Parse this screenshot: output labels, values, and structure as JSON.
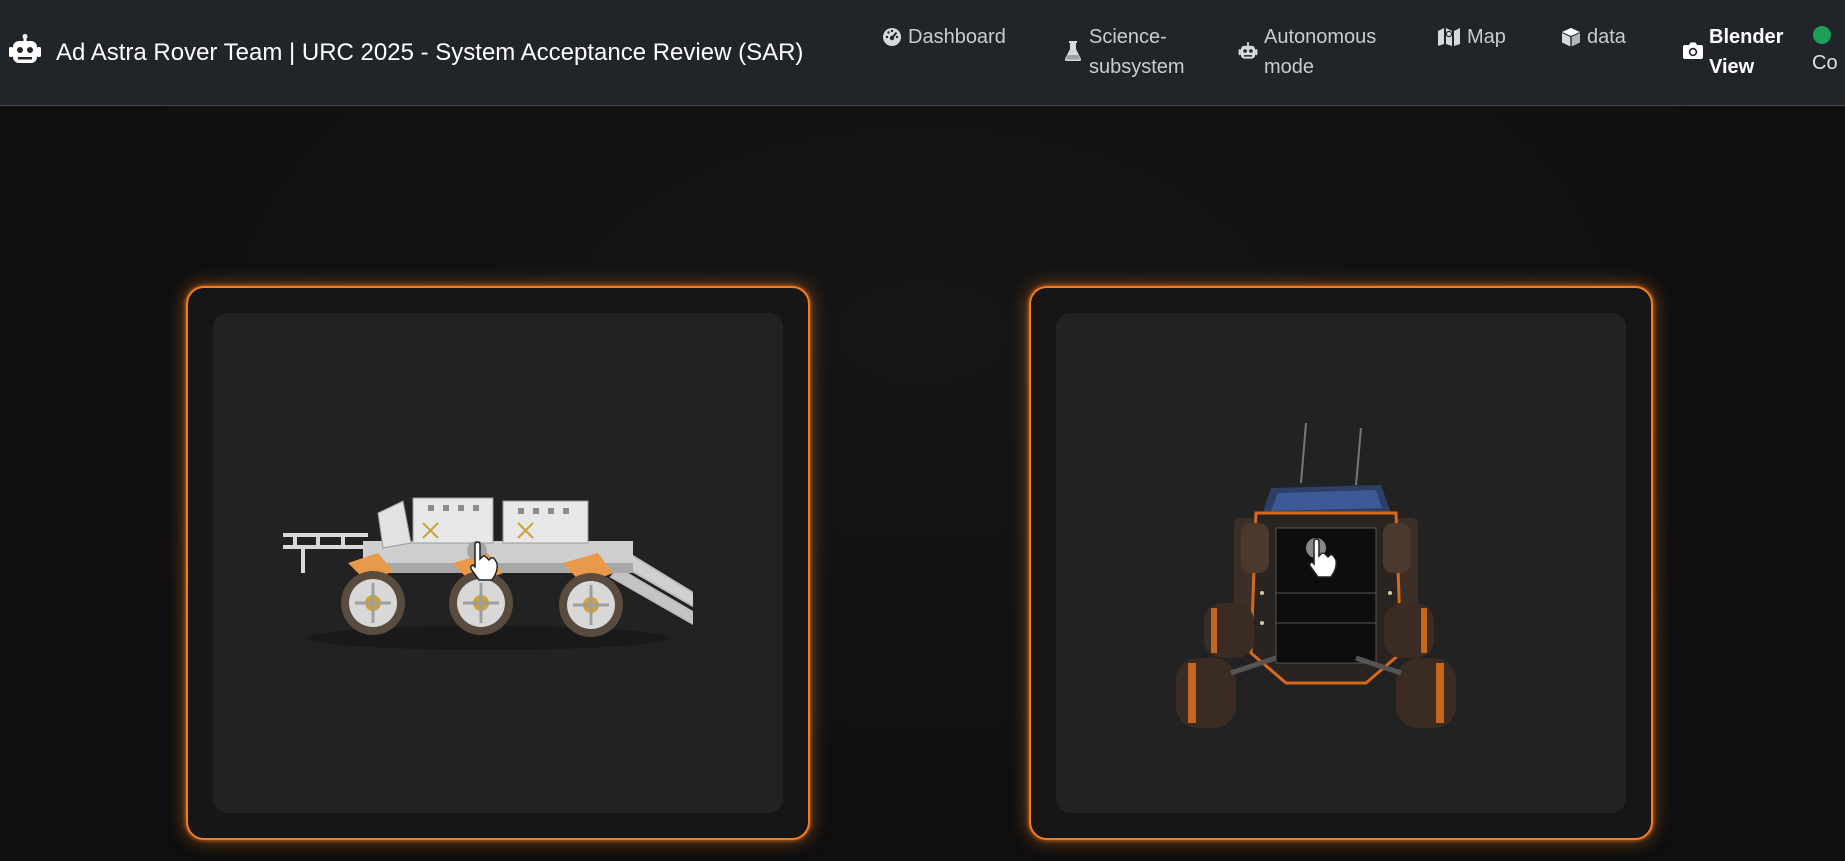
{
  "header": {
    "brand_icon": "robot-icon",
    "title": "Ad Astra Rover Team | URC 2025 - System Acceptance Review (SAR)"
  },
  "nav": {
    "items": [
      {
        "icon": "dashboard-gauge-icon",
        "label": "Dashboard",
        "active": false
      },
      {
        "icon": "flask-icon",
        "label": "Science-subsystem",
        "active": false
      },
      {
        "icon": "robot-icon",
        "label": "Autonomous mode",
        "active": false
      },
      {
        "icon": "map-icon",
        "label": "Map",
        "active": false
      },
      {
        "icon": "cube-icon",
        "label": "data",
        "active": false
      },
      {
        "icon": "camera-icon",
        "label": "Blender View",
        "active": true
      }
    ]
  },
  "status": {
    "color": "#1e9e5a",
    "label": "Co"
  },
  "cards": [
    {
      "model": "white rover with six wheels and ramp",
      "cursor": "hand-pointer-icon"
    },
    {
      "model": "dark orange armored rover with solar panels",
      "cursor": "hand-pointer-icon"
    }
  ],
  "colors": {
    "accent": "#f47b1e",
    "navbar_bg": "#212429",
    "page_bg": "#121212",
    "card_inner_bg": "#222222"
  }
}
